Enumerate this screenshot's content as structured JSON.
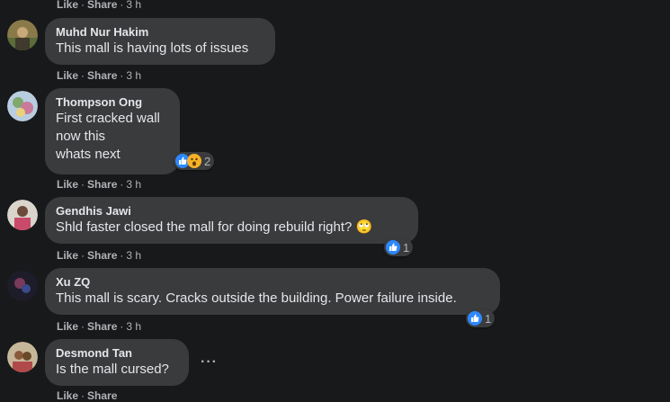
{
  "action_labels": {
    "like": "Like",
    "share": "Share",
    "sep": "·"
  },
  "top_actions": {
    "time": "3 h"
  },
  "comments": [
    {
      "author": "Muhd Nur Hakim",
      "lines": [
        "This mall is having lots of issues"
      ],
      "time": "3 h"
    },
    {
      "author": "Thompson Ong",
      "lines": [
        "First cracked wall",
        "now this",
        "whats next"
      ],
      "time": "3 h",
      "reactions": {
        "icons": [
          "like-icon",
          "wow-icon"
        ],
        "count": "2"
      }
    },
    {
      "author": "Gendhis Jawi",
      "lines": [
        "Shld faster closed the mall for doing rebuild right? 🙄"
      ],
      "time": "3 h",
      "reactions": {
        "icons": [
          "like-icon"
        ],
        "count": "1"
      }
    },
    {
      "author": "Xu ZQ",
      "lines": [
        "This mall is scary. Cracks outside the building. Power failure inside."
      ],
      "time": "3 h",
      "reactions": {
        "icons": [
          "like-icon"
        ],
        "count": "1"
      }
    },
    {
      "author": "Desmond Tan",
      "lines": [
        "Is the mall cursed?"
      ],
      "more": "···"
    }
  ],
  "colors": {
    "background": "#18191a",
    "bubble": "#3a3b3c",
    "text": "#e4e6eb",
    "muted": "#b0b3b8",
    "like_blue": "#2d88ff"
  }
}
